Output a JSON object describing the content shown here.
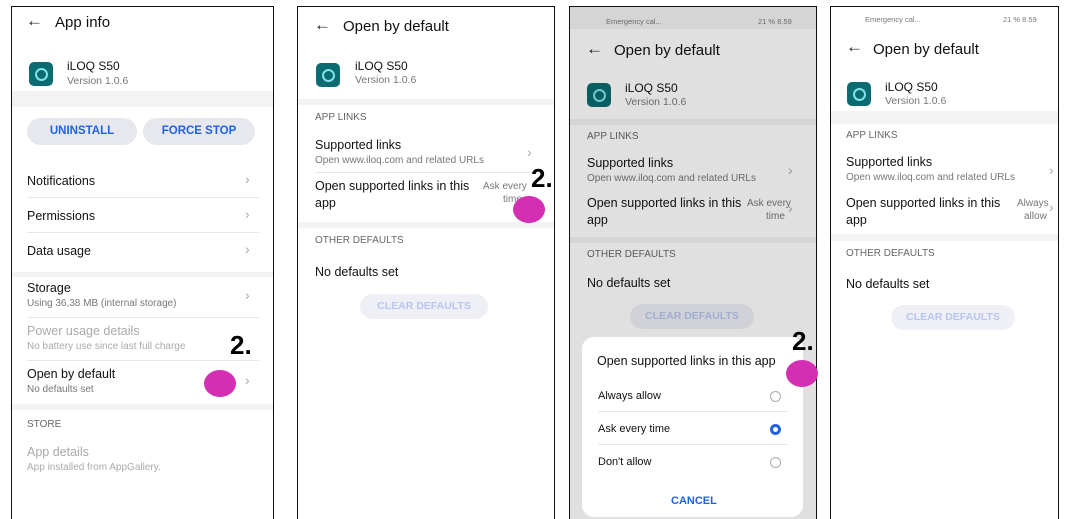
{
  "app": {
    "name": "iLOQ S50",
    "version": "Version 1.0.6"
  },
  "step_number": "2.",
  "status_bar": {
    "left": "Emergency cal...",
    "right": "21 %  8.59"
  },
  "panel1": {
    "title": "App info",
    "uninstall": "UNINSTALL",
    "force_stop": "FORCE STOP",
    "items": [
      "Notifications",
      "Permissions",
      "Data usage"
    ],
    "storage": {
      "title": "Storage",
      "sub": "Using 36,38 MB (internal storage)"
    },
    "power": {
      "title": "Power usage details",
      "sub": "No battery use since last full charge"
    },
    "open_default": {
      "title": "Open by default",
      "sub": "No defaults set"
    },
    "store_header": "STORE",
    "app_details": {
      "title": "App details",
      "sub": "App installed from AppGallery."
    }
  },
  "open_default": {
    "title": "Open by default",
    "app_links_header": "APP LINKS",
    "supported_links": "Supported links",
    "supported_links_sub": "Open www.iloq.com and related URLs",
    "open_supported_1": "Open supported links in this",
    "open_supported_2": "app",
    "ask_every_1": "Ask every",
    "ask_every_2": "time",
    "always_1": "Always",
    "always_2": "allow",
    "other_defaults_header": "OTHER DEFAULTS",
    "no_defaults": "No defaults set",
    "clear_defaults": "CLEAR DEFAULTS"
  },
  "dialog": {
    "title": "Open supported links in this app",
    "options": [
      "Always allow",
      "Ask every time",
      "Don't allow"
    ],
    "selected": "Ask every time",
    "cancel": "CANCEL"
  },
  "colors": {
    "accent": "#1f63e0",
    "marker": "#d42fb2",
    "app_icon": "#0c6b70"
  },
  "icons": {
    "back": "arrow-left",
    "chevron": "chevron-right",
    "app": "iloq-app-icon"
  }
}
